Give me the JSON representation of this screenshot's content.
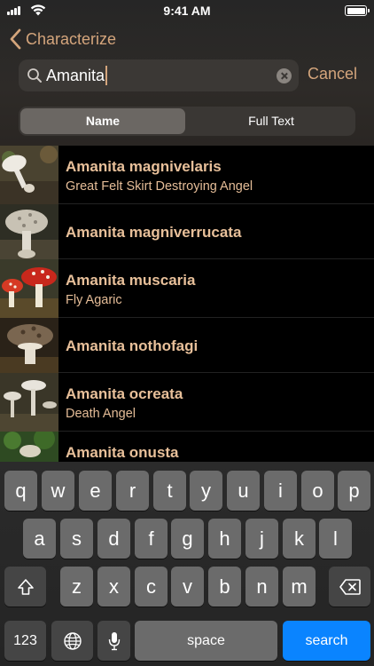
{
  "status_bar": {
    "time": "9:41 AM"
  },
  "nav": {
    "back_label": "Characterize"
  },
  "search": {
    "value": "Amanita",
    "cancel_label": "Cancel"
  },
  "segments": {
    "name_label": "Name",
    "full_text_label": "Full Text",
    "selected": "Name"
  },
  "results": [
    {
      "title": "Amanita magnivelaris",
      "subtitle": "Great Felt Skirt Destroying Angel"
    },
    {
      "title": "Amanita magniverrucata",
      "subtitle": ""
    },
    {
      "title": "Amanita muscaria",
      "subtitle": "Fly Agaric"
    },
    {
      "title": "Amanita nothofagi",
      "subtitle": ""
    },
    {
      "title": "Amanita ocreata",
      "subtitle": "Death Angel"
    },
    {
      "title": "Amanita onusta",
      "subtitle": ""
    }
  ],
  "keyboard": {
    "row1": [
      "q",
      "w",
      "e",
      "r",
      "t",
      "y",
      "u",
      "i",
      "o",
      "p"
    ],
    "row2": [
      "a",
      "s",
      "d",
      "f",
      "g",
      "h",
      "j",
      "k",
      "l"
    ],
    "row3": [
      "z",
      "x",
      "c",
      "v",
      "b",
      "n",
      "m"
    ],
    "numbers_label": "123",
    "space_label": "space",
    "search_label": "search"
  },
  "colors": {
    "accent": "#d4a57c",
    "result_title": "#e8c09a",
    "search_key": "#0a84ff"
  }
}
